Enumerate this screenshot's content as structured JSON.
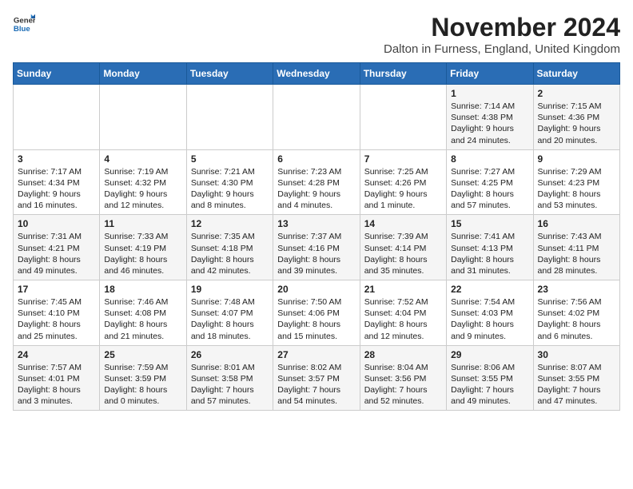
{
  "header": {
    "logo_general": "General",
    "logo_blue": "Blue",
    "month_title": "November 2024",
    "location": "Dalton in Furness, England, United Kingdom"
  },
  "weekdays": [
    "Sunday",
    "Monday",
    "Tuesday",
    "Wednesday",
    "Thursday",
    "Friday",
    "Saturday"
  ],
  "weeks": [
    [
      {
        "day": "",
        "info": ""
      },
      {
        "day": "",
        "info": ""
      },
      {
        "day": "",
        "info": ""
      },
      {
        "day": "",
        "info": ""
      },
      {
        "day": "",
        "info": ""
      },
      {
        "day": "1",
        "info": "Sunrise: 7:14 AM\nSunset: 4:38 PM\nDaylight: 9 hours and 24 minutes."
      },
      {
        "day": "2",
        "info": "Sunrise: 7:15 AM\nSunset: 4:36 PM\nDaylight: 9 hours and 20 minutes."
      }
    ],
    [
      {
        "day": "3",
        "info": "Sunrise: 7:17 AM\nSunset: 4:34 PM\nDaylight: 9 hours and 16 minutes."
      },
      {
        "day": "4",
        "info": "Sunrise: 7:19 AM\nSunset: 4:32 PM\nDaylight: 9 hours and 12 minutes."
      },
      {
        "day": "5",
        "info": "Sunrise: 7:21 AM\nSunset: 4:30 PM\nDaylight: 9 hours and 8 minutes."
      },
      {
        "day": "6",
        "info": "Sunrise: 7:23 AM\nSunset: 4:28 PM\nDaylight: 9 hours and 4 minutes."
      },
      {
        "day": "7",
        "info": "Sunrise: 7:25 AM\nSunset: 4:26 PM\nDaylight: 9 hours and 1 minute."
      },
      {
        "day": "8",
        "info": "Sunrise: 7:27 AM\nSunset: 4:25 PM\nDaylight: 8 hours and 57 minutes."
      },
      {
        "day": "9",
        "info": "Sunrise: 7:29 AM\nSunset: 4:23 PM\nDaylight: 8 hours and 53 minutes."
      }
    ],
    [
      {
        "day": "10",
        "info": "Sunrise: 7:31 AM\nSunset: 4:21 PM\nDaylight: 8 hours and 49 minutes."
      },
      {
        "day": "11",
        "info": "Sunrise: 7:33 AM\nSunset: 4:19 PM\nDaylight: 8 hours and 46 minutes."
      },
      {
        "day": "12",
        "info": "Sunrise: 7:35 AM\nSunset: 4:18 PM\nDaylight: 8 hours and 42 minutes."
      },
      {
        "day": "13",
        "info": "Sunrise: 7:37 AM\nSunset: 4:16 PM\nDaylight: 8 hours and 39 minutes."
      },
      {
        "day": "14",
        "info": "Sunrise: 7:39 AM\nSunset: 4:14 PM\nDaylight: 8 hours and 35 minutes."
      },
      {
        "day": "15",
        "info": "Sunrise: 7:41 AM\nSunset: 4:13 PM\nDaylight: 8 hours and 31 minutes."
      },
      {
        "day": "16",
        "info": "Sunrise: 7:43 AM\nSunset: 4:11 PM\nDaylight: 8 hours and 28 minutes."
      }
    ],
    [
      {
        "day": "17",
        "info": "Sunrise: 7:45 AM\nSunset: 4:10 PM\nDaylight: 8 hours and 25 minutes."
      },
      {
        "day": "18",
        "info": "Sunrise: 7:46 AM\nSunset: 4:08 PM\nDaylight: 8 hours and 21 minutes."
      },
      {
        "day": "19",
        "info": "Sunrise: 7:48 AM\nSunset: 4:07 PM\nDaylight: 8 hours and 18 minutes."
      },
      {
        "day": "20",
        "info": "Sunrise: 7:50 AM\nSunset: 4:06 PM\nDaylight: 8 hours and 15 minutes."
      },
      {
        "day": "21",
        "info": "Sunrise: 7:52 AM\nSunset: 4:04 PM\nDaylight: 8 hours and 12 minutes."
      },
      {
        "day": "22",
        "info": "Sunrise: 7:54 AM\nSunset: 4:03 PM\nDaylight: 8 hours and 9 minutes."
      },
      {
        "day": "23",
        "info": "Sunrise: 7:56 AM\nSunset: 4:02 PM\nDaylight: 8 hours and 6 minutes."
      }
    ],
    [
      {
        "day": "24",
        "info": "Sunrise: 7:57 AM\nSunset: 4:01 PM\nDaylight: 8 hours and 3 minutes."
      },
      {
        "day": "25",
        "info": "Sunrise: 7:59 AM\nSunset: 3:59 PM\nDaylight: 8 hours and 0 minutes."
      },
      {
        "day": "26",
        "info": "Sunrise: 8:01 AM\nSunset: 3:58 PM\nDaylight: 7 hours and 57 minutes."
      },
      {
        "day": "27",
        "info": "Sunrise: 8:02 AM\nSunset: 3:57 PM\nDaylight: 7 hours and 54 minutes."
      },
      {
        "day": "28",
        "info": "Sunrise: 8:04 AM\nSunset: 3:56 PM\nDaylight: 7 hours and 52 minutes."
      },
      {
        "day": "29",
        "info": "Sunrise: 8:06 AM\nSunset: 3:55 PM\nDaylight: 7 hours and 49 minutes."
      },
      {
        "day": "30",
        "info": "Sunrise: 8:07 AM\nSunset: 3:55 PM\nDaylight: 7 hours and 47 minutes."
      }
    ]
  ]
}
